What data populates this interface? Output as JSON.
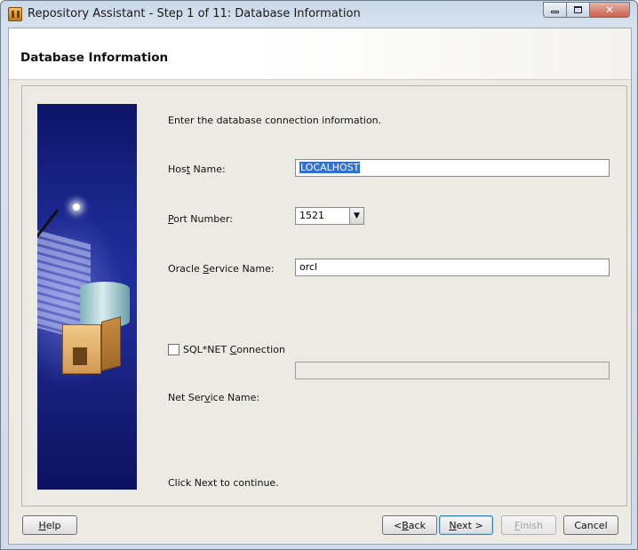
{
  "window": {
    "title": "Repository Assistant - Step 1 of 11: Database Information",
    "minimize_label": "",
    "maximize_label": "",
    "close_label": "✕"
  },
  "header": {
    "page_title": "Database Information"
  },
  "form": {
    "instruction": "Enter the database connection information.",
    "host_name": {
      "label_pre": "Hos",
      "label_mn": "t",
      "label_post": " Name:",
      "value": "LOCALHOST",
      "selected": true
    },
    "port_number": {
      "label_pre": "",
      "label_mn": "P",
      "label_post": "ort Number:",
      "value": "1521"
    },
    "service_name": {
      "label_pre": "Oracle ",
      "label_mn": "S",
      "label_post": "ervice Name:",
      "value": "orcl"
    },
    "sqlnet": {
      "label_pre": "SQL*NET ",
      "label_mn": "C",
      "label_post": "onnection",
      "checked": false
    },
    "net_service_name": {
      "label_pre": "Net Ser",
      "label_mn": "v",
      "label_post": "ice Name:",
      "value": "",
      "enabled": false
    },
    "footer": "Click Next to continue."
  },
  "buttons": {
    "help": {
      "mn": "H",
      "rest": "elp"
    },
    "back": {
      "pre": "< ",
      "mn": "B",
      "rest": "ack"
    },
    "next": {
      "mn": "N",
      "rest": "ext >"
    },
    "finish": {
      "mn": "F",
      "rest": "inish",
      "enabled": false
    },
    "cancel": {
      "label": "Cancel"
    }
  }
}
